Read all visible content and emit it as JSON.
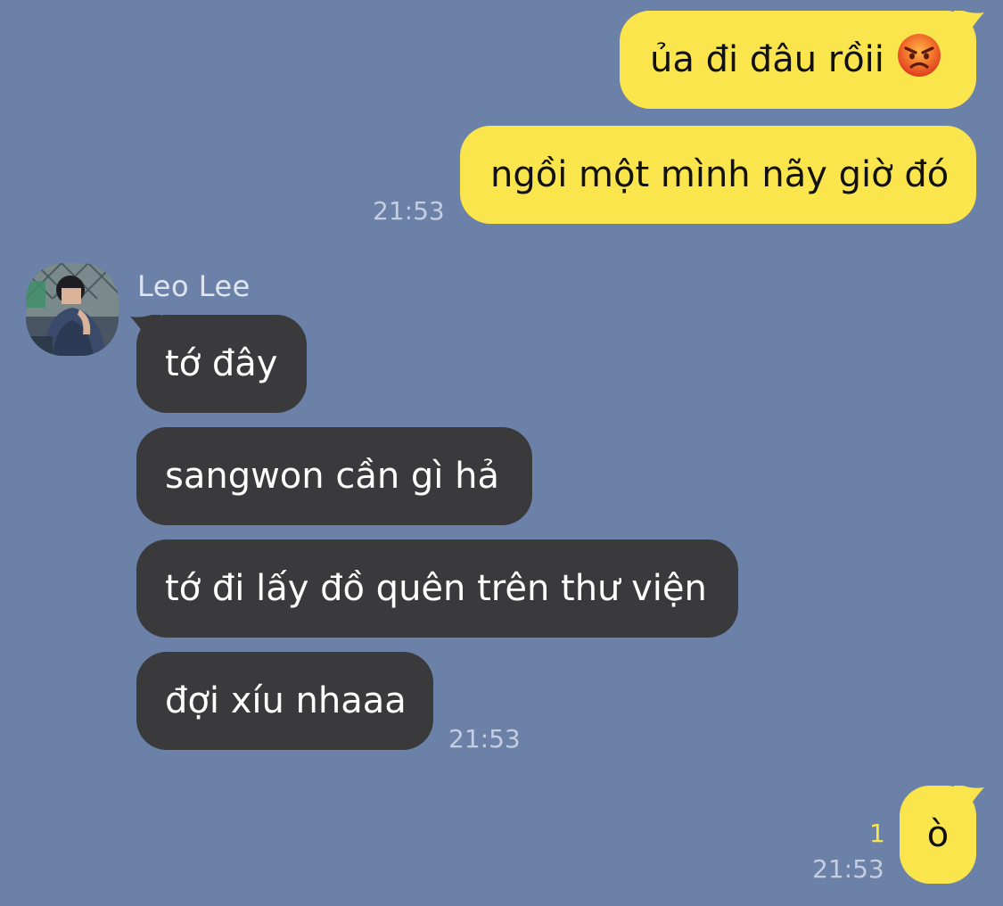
{
  "outgoing_group_1": {
    "messages": [
      "ủa đi đâu rồii",
      "ngồi một mình nãy giờ đó"
    ],
    "emoji": "angry-face",
    "time": "21:53"
  },
  "incoming_group": {
    "sender": "Leo Lee",
    "messages": [
      "tớ đây",
      "sangwon cần gì hả",
      "tớ đi lấy đồ quên trên thư viện",
      "đợi xíu nhaaa"
    ],
    "time": "21:53"
  },
  "outgoing_group_2": {
    "messages": [
      "ò"
    ],
    "unread_count": "1",
    "time": "21:53"
  },
  "colors": {
    "background": "#6c81a7",
    "outgoing_bubble": "#fbe54d",
    "incoming_bubble": "#3a3a3c",
    "unread": "#fbe54d"
  }
}
